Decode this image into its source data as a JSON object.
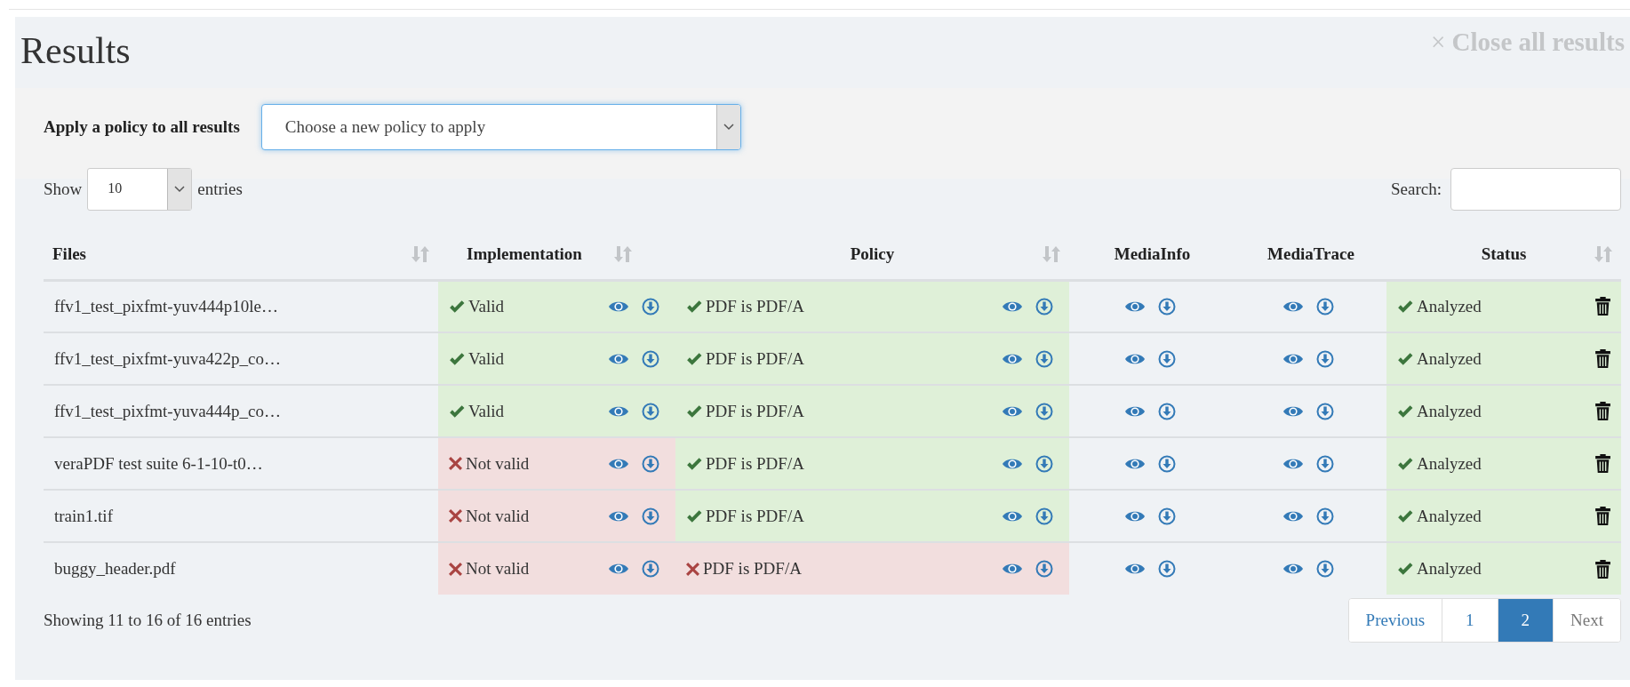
{
  "title": "Results",
  "close_all": {
    "label": "Close all results",
    "icon": "×"
  },
  "policy_bar": {
    "label": "Apply a policy to all results",
    "select": {
      "value": "Choose a new policy to apply"
    }
  },
  "length": {
    "prefix": "Show",
    "value": "10",
    "suffix": "entries"
  },
  "search": {
    "label": "Search:"
  },
  "table": {
    "columns": [
      {
        "label": "Files",
        "sortable": true
      },
      {
        "label": "Implementation",
        "sortable": true
      },
      {
        "label": "Policy",
        "sortable": true
      },
      {
        "label": "MediaInfo",
        "sortable": false
      },
      {
        "label": "MediaTrace",
        "sortable": false
      },
      {
        "label": "Status",
        "sortable": true
      }
    ],
    "rows": [
      {
        "file": "ffv1_test_pixfmt-yuv444p10le…",
        "implementation": {
          "label": "Valid",
          "valid": true
        },
        "policy": {
          "label": "PDF is PDF/A",
          "valid": true
        },
        "status": {
          "label": "Analyzed",
          "ok": true
        }
      },
      {
        "file": "ffv1_test_pixfmt-yuva422p_co…",
        "implementation": {
          "label": "Valid",
          "valid": true
        },
        "policy": {
          "label": "PDF is PDF/A",
          "valid": true
        },
        "status": {
          "label": "Analyzed",
          "ok": true
        }
      },
      {
        "file": "ffv1_test_pixfmt-yuva444p_co…",
        "implementation": {
          "label": "Valid",
          "valid": true
        },
        "policy": {
          "label": "PDF is PDF/A",
          "valid": true
        },
        "status": {
          "label": "Analyzed",
          "ok": true
        }
      },
      {
        "file": "veraPDF test suite 6-1-10-t0…",
        "implementation": {
          "label": "Not valid",
          "valid": false
        },
        "policy": {
          "label": "PDF is PDF/A",
          "valid": true
        },
        "status": {
          "label": "Analyzed",
          "ok": true
        }
      },
      {
        "file": "train1.tif",
        "implementation": {
          "label": "Not valid",
          "valid": false
        },
        "policy": {
          "label": "PDF is PDF/A",
          "valid": true
        },
        "status": {
          "label": "Analyzed",
          "ok": true
        }
      },
      {
        "file": "buggy_header.pdf",
        "implementation": {
          "label": "Not valid",
          "valid": false
        },
        "policy": {
          "label": "PDF is PDF/A",
          "valid": false
        },
        "status": {
          "label": "Analyzed",
          "ok": true
        }
      }
    ]
  },
  "info": "Showing 11 to 16 of 16 entries",
  "pagination": [
    {
      "label": "Previous",
      "kind": "nav",
      "selected": false,
      "disabled": false
    },
    {
      "label": "1",
      "kind": "page",
      "selected": false,
      "disabled": false
    },
    {
      "label": "2",
      "kind": "page",
      "selected": true,
      "disabled": false
    },
    {
      "label": "Next",
      "kind": "nav",
      "selected": false,
      "disabled": true
    }
  ]
}
